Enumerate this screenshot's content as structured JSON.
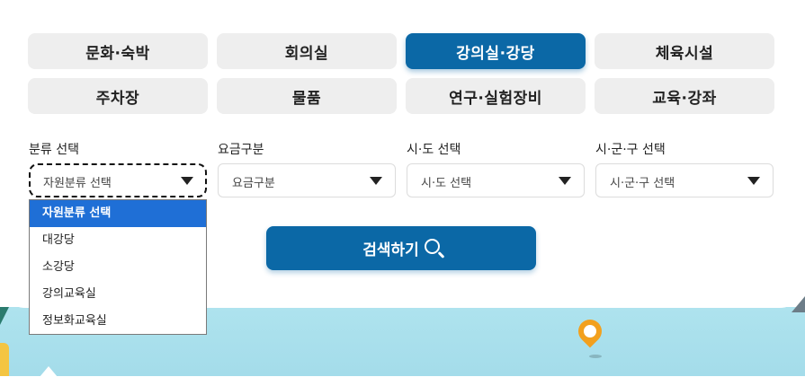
{
  "categories": {
    "tabs": [
      {
        "label": "문화·숙박",
        "active": false
      },
      {
        "label": "회의실",
        "active": false
      },
      {
        "label": "강의실·강당",
        "active": true
      },
      {
        "label": "체육시설",
        "active": false
      },
      {
        "label": "주차장",
        "active": false
      },
      {
        "label": "물품",
        "active": false
      },
      {
        "label": "연구·실험장비",
        "active": false
      },
      {
        "label": "교육·강좌",
        "active": false
      }
    ]
  },
  "filters": {
    "resource_type": {
      "label": "분류 선택",
      "value": "자원분류 선택"
    },
    "fee_type": {
      "label": "요금구분",
      "value": "요금구분"
    },
    "province": {
      "label": "시·도 선택",
      "value": "시·도 선택"
    },
    "district": {
      "label": "시·군·구 선택",
      "value": "시·군·구 선택"
    }
  },
  "dropdown": {
    "options": [
      "자원분류 선택",
      "대강당",
      "소강당",
      "강의교육실",
      "정보화교육실"
    ],
    "selected_index": 0,
    "highlight_color": "#1f6fd6"
  },
  "search": {
    "label": "검색하기"
  },
  "colors": {
    "accent": "#0b68a6",
    "tab_bg": "#eeeeee",
    "scene_bg": "#aee3ee"
  }
}
